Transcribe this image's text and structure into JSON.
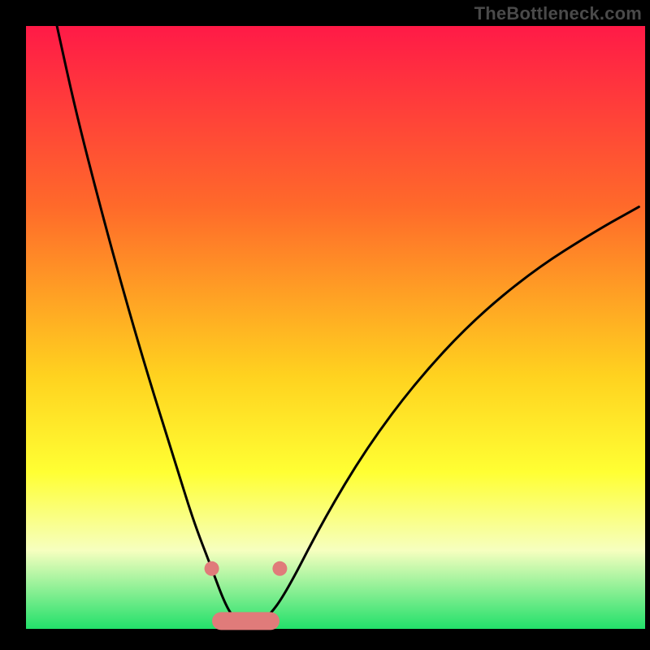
{
  "watermark": "TheBottleneck.com",
  "colors": {
    "frame_bg": "#000000",
    "grad_top": "#ff1a47",
    "grad_mid1": "#ff6a2a",
    "grad_mid2": "#ffd21f",
    "grad_mid3": "#ffff33",
    "grad_low": "#f6ffbf",
    "grad_bottom": "#22e06a",
    "curve": "#000000",
    "marker_fill": "#e07b7a",
    "marker_stroke": "#e07b7a"
  },
  "chart_data": {
    "type": "line",
    "title": "",
    "xlabel": "",
    "ylabel": "",
    "xlim": [
      0,
      100
    ],
    "ylim": [
      0,
      100
    ],
    "legend": false,
    "grid": false,
    "series": [
      {
        "name": "bottleneck-curve",
        "x": [
          5,
          8,
          12,
          16,
          20,
          24,
          27,
          30,
          32,
          33.5,
          35,
          37,
          39,
          42,
          48,
          55,
          63,
          72,
          82,
          92,
          99
        ],
        "y": [
          100,
          86,
          70,
          55,
          41,
          28,
          18,
          10,
          4.5,
          1.8,
          0.8,
          0.8,
          1.8,
          6,
          18,
          30,
          41,
          51,
          59.5,
          66,
          70
        ]
      }
    ],
    "markers": {
      "name": "highlight-band",
      "dots": [
        {
          "x": 30.0,
          "y": 10.0
        },
        {
          "x": 41.0,
          "y": 10.0
        }
      ],
      "bar_segment": {
        "x_start": 31.5,
        "x_end": 39.5,
        "y": 1.3
      }
    },
    "gradient_stops": [
      {
        "pct": 0,
        "color": "#ff1a47"
      },
      {
        "pct": 30,
        "color": "#ff6a2a"
      },
      {
        "pct": 58,
        "color": "#ffd21f"
      },
      {
        "pct": 74,
        "color": "#ffff33"
      },
      {
        "pct": 87,
        "color": "#f6ffbf"
      },
      {
        "pct": 100,
        "color": "#22e06a"
      }
    ]
  }
}
